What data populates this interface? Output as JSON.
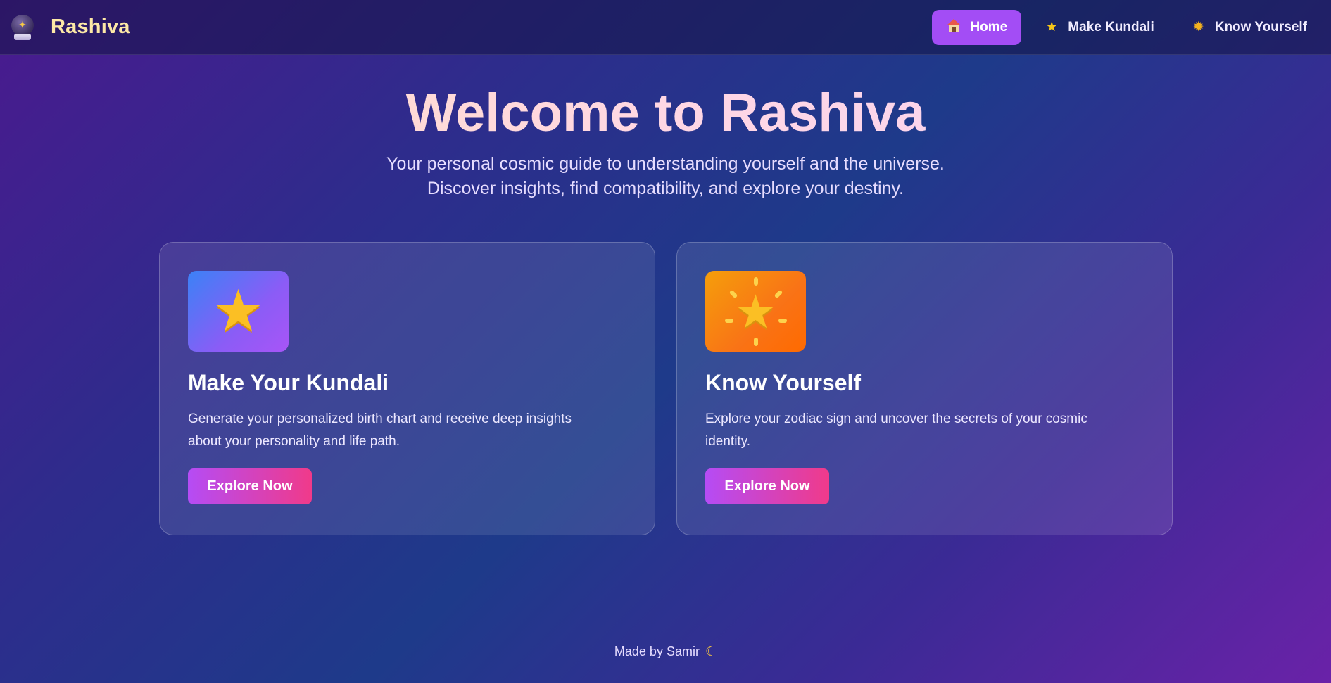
{
  "app": {
    "name": "Rashiva",
    "icon": "crystal-ball-icon"
  },
  "nav": {
    "items": [
      {
        "label": "Home",
        "icon": "house-icon",
        "active": true
      },
      {
        "label": "Make Kundali",
        "icon": "star-icon",
        "active": false
      },
      {
        "label": "Know Yourself",
        "icon": "sun-icon",
        "active": false
      }
    ]
  },
  "hero": {
    "title": "Welcome to Rashiva",
    "subtitle_line1": "Your personal cosmic guide to understanding yourself and the universe.",
    "subtitle_line2": "Discover insights, find compatibility, and explore your destiny."
  },
  "cards": [
    {
      "icon": "star-icon",
      "title": "Make Your Kundali",
      "text": "Generate your personalized birth chart and receive deep insights about your personality and life path.",
      "button": "Explore Now"
    },
    {
      "icon": "glowing-star-icon",
      "title": "Know Yourself",
      "text": "Explore your zodiac sign and uncover the secrets of your cosmic identity.",
      "button": "Explore Now"
    }
  ],
  "footer": {
    "text": "Made by Samir",
    "icon": "crescent-moon-icon"
  },
  "colors": {
    "accent": "#a34df5",
    "button_gradient_start": "#b54cf5",
    "button_gradient_end": "#f03a8a",
    "brand_text": "#fde8a6"
  }
}
